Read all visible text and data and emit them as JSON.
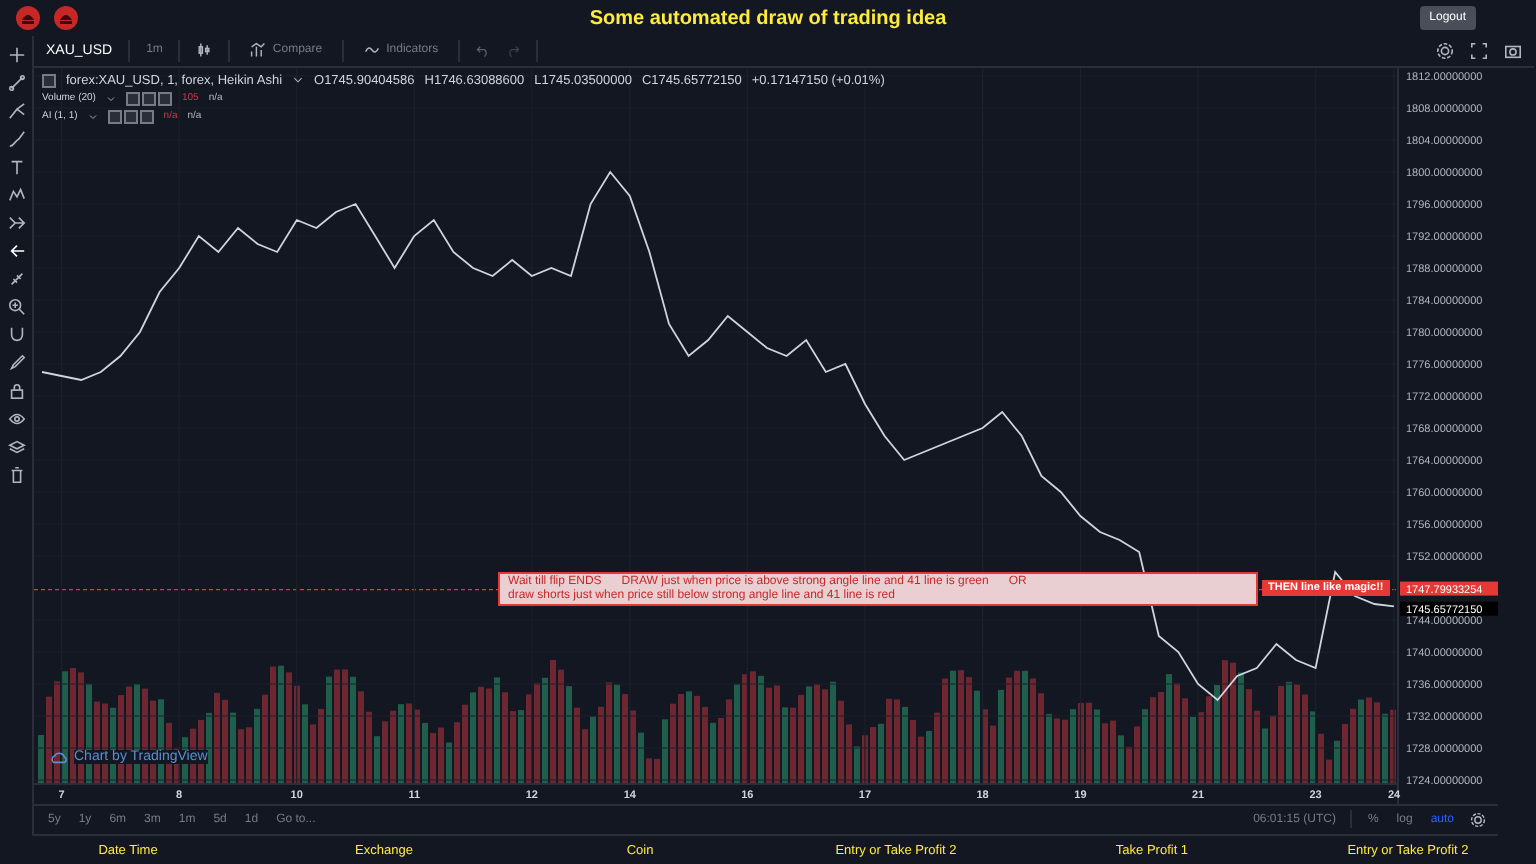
{
  "header": {
    "title": "Some automated draw of trading idea",
    "logout": "Logout"
  },
  "toolbar": {
    "symbol": "XAU_USD",
    "interval": "1m",
    "compare": "Compare",
    "indicators": "Indicators"
  },
  "legend": {
    "checked": false,
    "series": "forex:XAU_USD, 1, forex, Heikin Ashi",
    "ohlc": [
      "O1745.90404586",
      "H1746.63088600",
      "L1745.03500000",
      "C1745.65772150",
      "+0.17147150 (+0.01%)"
    ],
    "studies": [
      {
        "name": "Volume (20)",
        "values": [
          "105",
          "n/a"
        ]
      },
      {
        "name": "AI (1, 1)",
        "values": [
          "n/a",
          "n/a"
        ]
      }
    ]
  },
  "chart": {
    "chart_data": {
      "type": "line",
      "grid": true,
      "ylim": [
        1723,
        1813
      ],
      "categories": [
        null,
        "7",
        null,
        null,
        null,
        null,
        null,
        "8",
        null,
        null,
        null,
        null,
        null,
        "10",
        null,
        null,
        null,
        null,
        null,
        "11",
        null,
        null,
        null,
        null,
        null,
        "12",
        null,
        null,
        null,
        null,
        "14",
        null,
        null,
        null,
        null,
        null,
        "16",
        null,
        null,
        null,
        null,
        null,
        "17",
        null,
        null,
        null,
        null,
        null,
        "18",
        null,
        null,
        null,
        null,
        "19",
        null,
        null,
        null,
        null,
        null,
        "21",
        null,
        null,
        null,
        null,
        null,
        "23",
        null,
        null,
        null,
        "24"
      ],
      "series": [
        {
          "color": "#d1d4dc",
          "values": [
            1775,
            1774.5,
            1774,
            1775,
            1777,
            1780,
            1785,
            1788,
            1792,
            1790,
            1793,
            1791,
            1790,
            1794,
            1793,
            1795,
            1796,
            1792,
            1788,
            1792,
            1794,
            1790,
            1788,
            1787,
            1789,
            1787,
            1788,
            1787,
            1796,
            1800,
            1797,
            1790,
            1781,
            1777,
            1779,
            1782,
            1780,
            1778,
            1777,
            1779,
            1775,
            1776,
            1771,
            1767,
            1764,
            1765,
            1766,
            1767,
            1768,
            1770,
            1767,
            1762,
            1760,
            1757,
            1755,
            1754,
            1752.5,
            1742,
            1740,
            1736,
            1734,
            1737,
            1738,
            1741,
            1739,
            1738,
            1750,
            1747,
            1746,
            1745.7
          ]
        }
      ],
      "yticks": [
        {
          "value": 1812,
          "label": "1812.00000000"
        },
        {
          "value": 1808,
          "label": "1808.00000000"
        },
        {
          "value": 1804,
          "label": "1804.00000000"
        },
        {
          "value": 1800,
          "label": "1800.00000000"
        },
        {
          "value": 1796,
          "label": "1796.00000000"
        },
        {
          "value": 1792,
          "label": "1792.00000000"
        },
        {
          "value": 1788,
          "label": "1788.00000000"
        },
        {
          "value": 1784,
          "label": "1784.00000000"
        },
        {
          "value": 1780,
          "label": "1780.00000000"
        },
        {
          "value": 1776,
          "label": "1776.00000000"
        },
        {
          "value": 1772,
          "label": "1772.00000000"
        },
        {
          "value": 1768,
          "label": "1768.00000000"
        },
        {
          "value": 1764,
          "label": "1764.00000000"
        },
        {
          "value": 1760,
          "label": "1760.00000000"
        },
        {
          "value": 1756,
          "label": "1756.00000000"
        },
        {
          "value": 1752,
          "label": "1752.00000000"
        },
        {
          "value": 1744,
          "label": "1744.00000000"
        },
        {
          "value": 1740,
          "label": "1740.00000000"
        },
        {
          "value": 1736,
          "label": "1736.00000000"
        },
        {
          "value": 1732,
          "label": "1732.00000000"
        },
        {
          "value": 1728,
          "label": "1728.00000000"
        },
        {
          "value": 1724,
          "label": "1724.00000000"
        }
      ]
    },
    "price_markers": [
      {
        "label": "1747.79933254",
        "color": "#e53935"
      },
      {
        "label": "1745.65772150",
        "color": "#000000"
      }
    ],
    "annotation": {
      "segments": [
        "Wait till flip ENDS",
        "DRAW just when  price is above strong angle line and 41 line is green",
        "OR",
        "draw shorts just when price still below strong angle line and 41 line is red"
      ],
      "callout": "THEN line like magic!!"
    },
    "attribution": "Chart by TradingView"
  },
  "range_bar": {
    "ranges": [
      "5y",
      "1y",
      "6m",
      "3m",
      "1m",
      "5d",
      "1d"
    ],
    "goto": "Go to...",
    "clock": "06:01:15 (UTC)",
    "options": [
      {
        "label": "%",
        "selected": false
      },
      {
        "label": "log",
        "selected": false
      },
      {
        "label": "auto",
        "selected": true
      }
    ]
  },
  "footer": [
    "Date Time",
    "Exchange",
    "Coin",
    "Entry or Take Profit 2",
    "Take Profit 1",
    "Entry or Take Profit 2"
  ]
}
